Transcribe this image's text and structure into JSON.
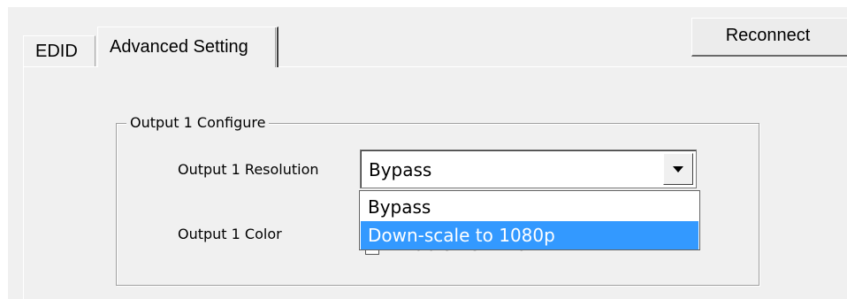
{
  "tabs": [
    {
      "label": "EDID",
      "active": false
    },
    {
      "label": "Advanced Setting",
      "active": true
    }
  ],
  "reconnect_label": "Reconnect",
  "output1": {
    "group_title": "Output 1 Configure",
    "resolution_label": "Output 1 Resolution",
    "resolution_value": "Bypass",
    "resolution_options": [
      "Bypass",
      "Down-scale to 1080p"
    ],
    "highlighted_option": "Down-scale to 1080p",
    "color_label": "Output 1 Color",
    "color_checkbox_label": "Enable YUV420"
  },
  "colors": {
    "selection": "#3399ff",
    "window": "#f0f0f0"
  }
}
